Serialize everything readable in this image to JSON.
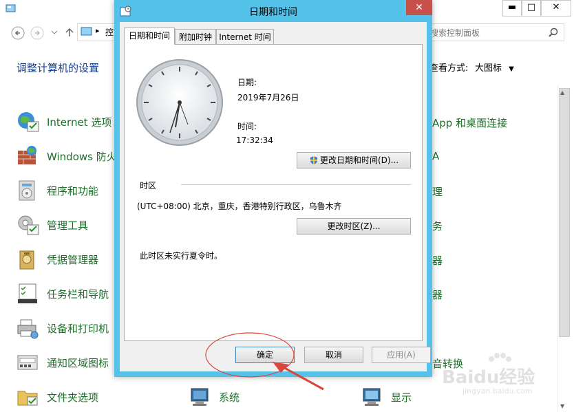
{
  "control_panel": {
    "address_text": "控",
    "search_placeholder": "搜索控制面板",
    "heading": "调整计算机的设置",
    "view_by_label": "查看方式:",
    "view_by_value": "大图标",
    "items_left": [
      "Internet 选项",
      "Windows 防火墙",
      "程序和功能",
      "管理工具",
      "凭据管理器",
      "任务栏和导航",
      "设备和打印机",
      "通知区域图标",
      "文件夹选项"
    ],
    "item_center": "系统",
    "item_right_bottom": "显示",
    "items_right": [
      "App 和桌面连接",
      "A",
      "理",
      "务",
      "器",
      "器",
      "音转换"
    ]
  },
  "dialog": {
    "title": "日期和时间",
    "close_glyph": "✕",
    "tabs": [
      "日期和时间",
      "附加时钟",
      "Internet 时间"
    ],
    "date_label": "日期:",
    "date_value": "2019年7月26日",
    "time_label": "时间:",
    "time_value": "17:32:34",
    "change_datetime_button": "更改日期和时间(D)...",
    "timezone_section_label": "时区",
    "timezone_value": "(UTC+08:00) 北京，重庆，香港特别行政区，乌鲁木齐",
    "change_timezone_button": "更改时区(Z)...",
    "dst_note": "此时区未实行夏令时。",
    "ok_button": "确定",
    "cancel_button": "取消",
    "apply_button": "应用(A)"
  },
  "watermark": {
    "brand": "Baidu经验",
    "url": "jingyan.baidu.com"
  },
  "colors": {
    "dialog_frame": "#55c2ea",
    "close_button": "#c7504a",
    "link_green": "#1e6f2a",
    "annotation_red": "#d9463b"
  }
}
